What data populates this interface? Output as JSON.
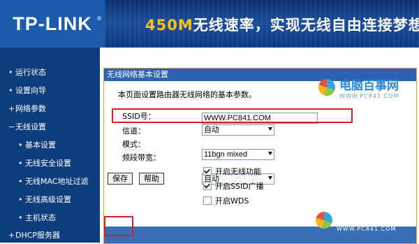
{
  "header": {
    "logo": "TP-LINK",
    "logo_mark": "®",
    "slogan_highlight": "450M",
    "slogan_rest": "无线速率，实现无线自由连接梦想"
  },
  "sidebar": {
    "items": [
      {
        "bullet": "•",
        "label": "运行状态"
      },
      {
        "bullet": "•",
        "label": "设置向导"
      },
      {
        "bullet": "+",
        "label": "网络参数"
      },
      {
        "bullet": "−",
        "label": "无线设置"
      },
      {
        "bullet": "•",
        "label": "基本设置"
      },
      {
        "bullet": "•",
        "label": "无线安全设置"
      },
      {
        "bullet": "•",
        "label": "无线MAC地址过滤"
      },
      {
        "bullet": "•",
        "label": "无线高级设置"
      },
      {
        "bullet": "•",
        "label": "主机状态"
      },
      {
        "bullet": "+",
        "label": "DHCP服务器"
      }
    ]
  },
  "panel": {
    "title": "无线网络基本设置",
    "description": "本页面设置路由器无线网络的基本参数。",
    "ssid_label": "SSID号：",
    "ssid_value": "WWW.PC841.COM",
    "channel_label": "信道：",
    "channel_value": "自动",
    "mode_label": "模式：",
    "mode_value": "11bgn mixed",
    "bandwidth_label": "频段带宽：",
    "bandwidth_value": "自动",
    "enable_wireless_label": "开启无线功能",
    "enable_wireless_checked": true,
    "ssid_broadcast_label": "开启SSID广播",
    "ssid_broadcast_checked": true,
    "wds_label": "开启WDS",
    "wds_checked": false,
    "save_label": "保存",
    "help_label": "帮助"
  },
  "watermark": {
    "title": "电脑百事网",
    "url": "WWW.PC841.COM"
  }
}
